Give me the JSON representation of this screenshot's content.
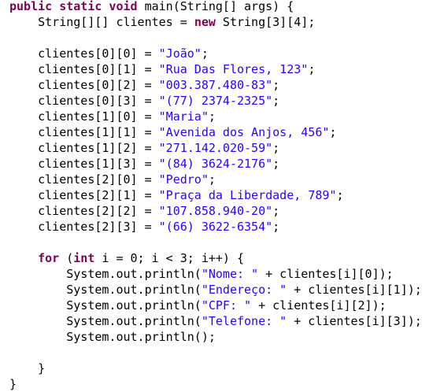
{
  "colors": {
    "background": "#ffffff",
    "keyword": "#7f0055",
    "string": "#2a00ff",
    "text": "#000000"
  },
  "lines": [
    [
      {
        "t": "kw",
        "v": "public static void"
      },
      {
        "t": "plain",
        "v": " main(String[] args) {"
      }
    ],
    [
      {
        "t": "plain",
        "v": "    String[][] clientes = "
      },
      {
        "t": "kw",
        "v": "new"
      },
      {
        "t": "plain",
        "v": " String[3][4];"
      }
    ],
    [],
    [
      {
        "t": "plain",
        "v": "    clientes[0][0] = "
      },
      {
        "t": "str",
        "v": "\"João\""
      },
      {
        "t": "plain",
        "v": ";"
      }
    ],
    [
      {
        "t": "plain",
        "v": "    clientes[0][1] = "
      },
      {
        "t": "str",
        "v": "\"Rua Das Flores, 123\""
      },
      {
        "t": "plain",
        "v": ";"
      }
    ],
    [
      {
        "t": "plain",
        "v": "    clientes[0][2] = "
      },
      {
        "t": "str",
        "v": "\"003.387.480-83\""
      },
      {
        "t": "plain",
        "v": ";"
      }
    ],
    [
      {
        "t": "plain",
        "v": "    clientes[0][3] = "
      },
      {
        "t": "str",
        "v": "\"(77) 2374-2325\""
      },
      {
        "t": "plain",
        "v": ";"
      }
    ],
    [
      {
        "t": "plain",
        "v": "    clientes[1][0] = "
      },
      {
        "t": "str",
        "v": "\"Maria\""
      },
      {
        "t": "plain",
        "v": ";"
      }
    ],
    [
      {
        "t": "plain",
        "v": "    clientes[1][1] = "
      },
      {
        "t": "str",
        "v": "\"Avenida dos Anjos, 456\""
      },
      {
        "t": "plain",
        "v": ";"
      }
    ],
    [
      {
        "t": "plain",
        "v": "    clientes[1][2] = "
      },
      {
        "t": "str",
        "v": "\"271.142.020-59\""
      },
      {
        "t": "plain",
        "v": ";"
      }
    ],
    [
      {
        "t": "plain",
        "v": "    clientes[1][3] = "
      },
      {
        "t": "str",
        "v": "\"(84) 3624-2176\""
      },
      {
        "t": "plain",
        "v": ";"
      }
    ],
    [
      {
        "t": "plain",
        "v": "    clientes[2][0] = "
      },
      {
        "t": "str",
        "v": "\"Pedro\""
      },
      {
        "t": "plain",
        "v": ";"
      }
    ],
    [
      {
        "t": "plain",
        "v": "    clientes[2][1] = "
      },
      {
        "t": "str",
        "v": "\"Praça da Liberdade, 789\""
      },
      {
        "t": "plain",
        "v": ";"
      }
    ],
    [
      {
        "t": "plain",
        "v": "    clientes[2][2] = "
      },
      {
        "t": "str",
        "v": "\"107.858.940-20\""
      },
      {
        "t": "plain",
        "v": ";"
      }
    ],
    [
      {
        "t": "plain",
        "v": "    clientes[2][3] = "
      },
      {
        "t": "str",
        "v": "\"(66) 3622-6354\""
      },
      {
        "t": "plain",
        "v": ";"
      }
    ],
    [],
    [
      {
        "t": "plain",
        "v": "    "
      },
      {
        "t": "kw",
        "v": "for"
      },
      {
        "t": "plain",
        "v": " ("
      },
      {
        "t": "kw",
        "v": "int"
      },
      {
        "t": "plain",
        "v": " i = 0; i < 3; i++) {"
      }
    ],
    [
      {
        "t": "plain",
        "v": "        System.out.println("
      },
      {
        "t": "str",
        "v": "\"Nome: \""
      },
      {
        "t": "plain",
        "v": " + clientes[i][0]);"
      }
    ],
    [
      {
        "t": "plain",
        "v": "        System.out.println("
      },
      {
        "t": "str",
        "v": "\"Endereço: \""
      },
      {
        "t": "plain",
        "v": " + clientes[i][1]);"
      }
    ],
    [
      {
        "t": "plain",
        "v": "        System.out.println("
      },
      {
        "t": "str",
        "v": "\"CPF: \""
      },
      {
        "t": "plain",
        "v": " + clientes[i][2]);"
      }
    ],
    [
      {
        "t": "plain",
        "v": "        System.out.println("
      },
      {
        "t": "str",
        "v": "\"Telefone: \""
      },
      {
        "t": "plain",
        "v": " + clientes[i][3]);"
      }
    ],
    [
      {
        "t": "plain",
        "v": "        System.out.println();"
      }
    ],
    [],
    [
      {
        "t": "plain",
        "v": "    }"
      }
    ],
    [
      {
        "t": "plain",
        "v": "}"
      }
    ]
  ]
}
